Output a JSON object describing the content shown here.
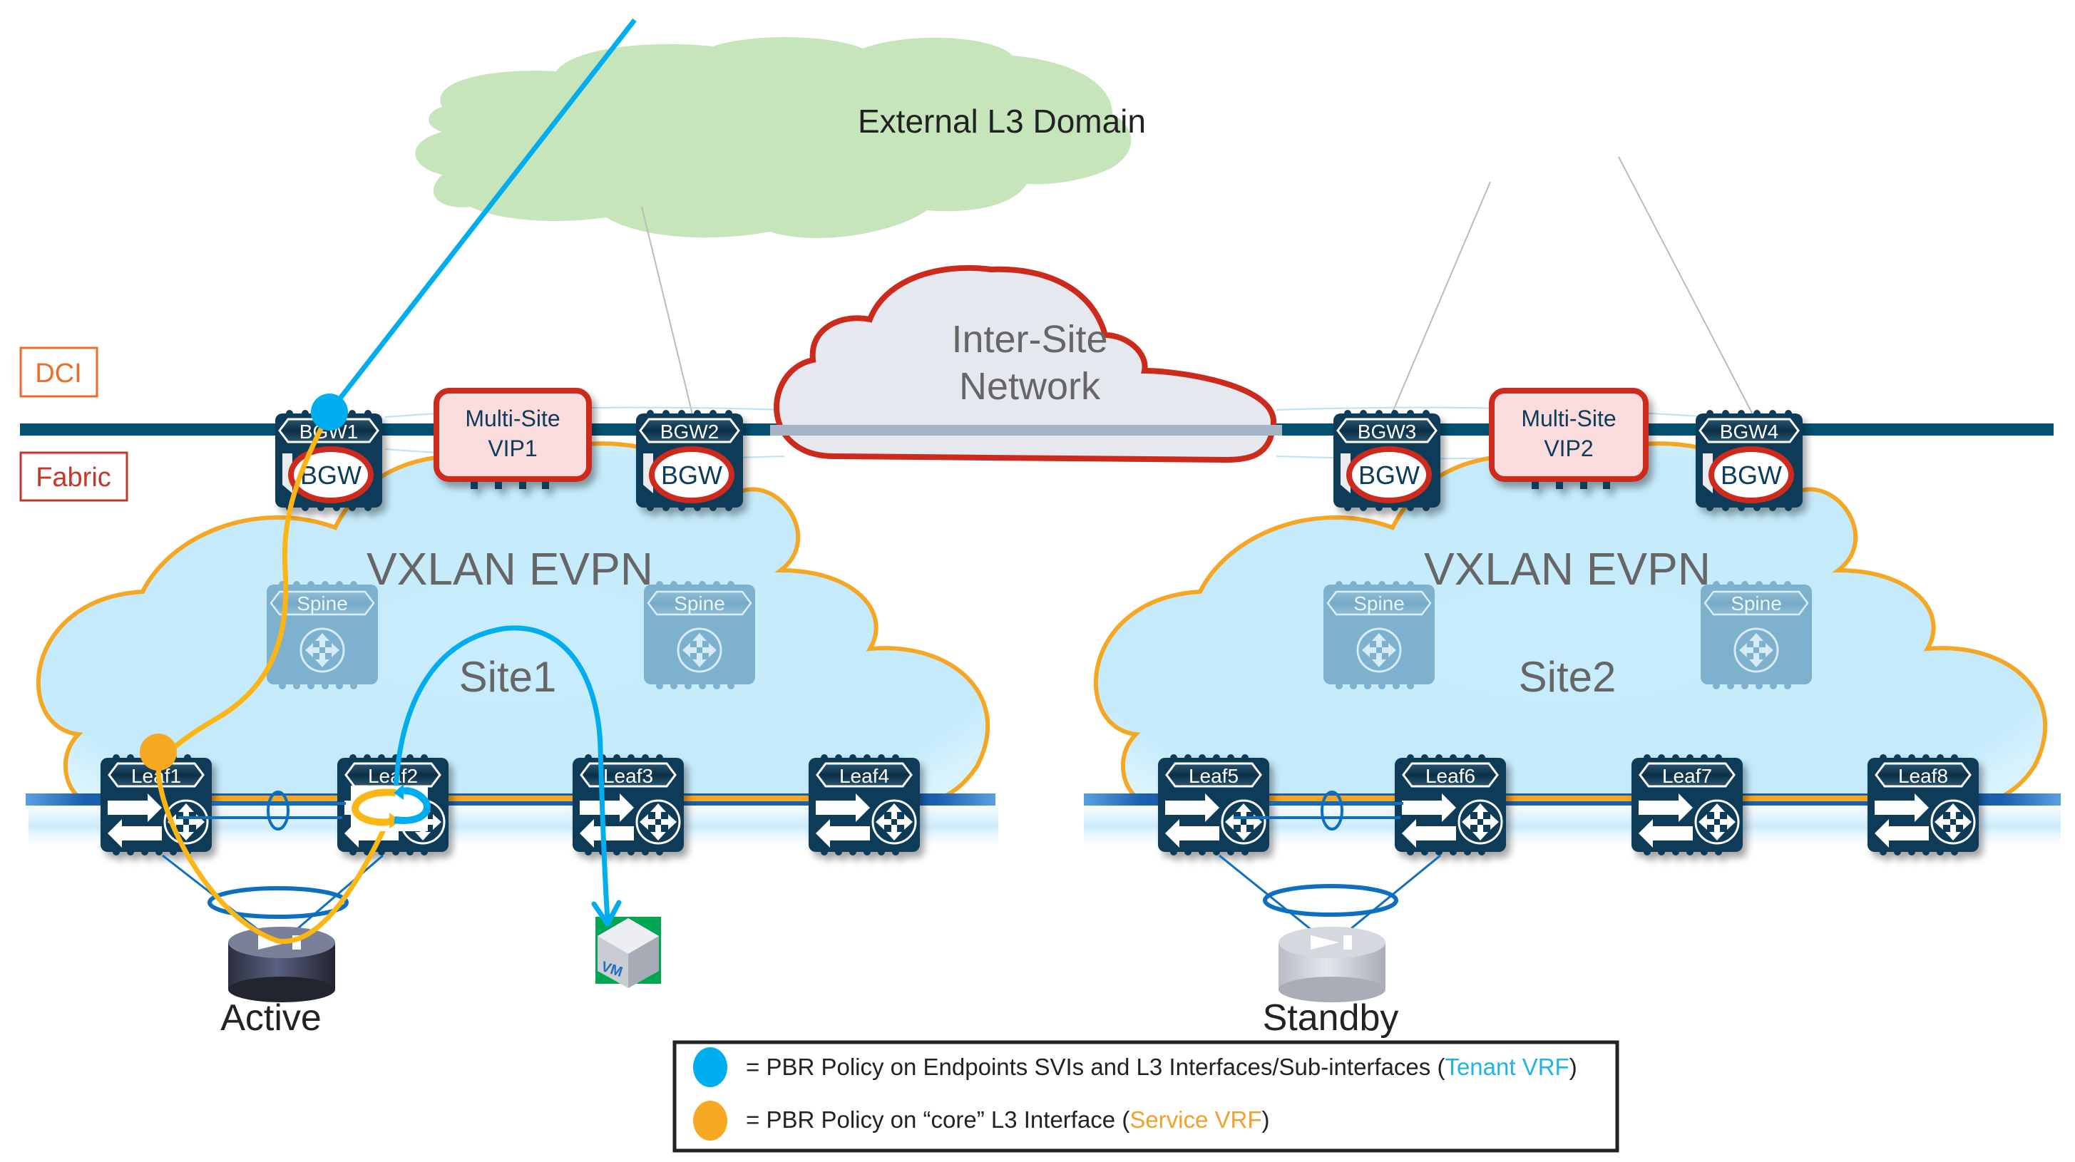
{
  "external_cloud": {
    "label": "External L3 Domain"
  },
  "inter_site_cloud": {
    "line1": "Inter-Site",
    "line2": "Network"
  },
  "layers": {
    "dci": "DCI",
    "fabric": "Fabric"
  },
  "sites": [
    {
      "name": "Site1",
      "fabric_label": "VXLAN EVPN",
      "vip": {
        "line1": "Multi-Site",
        "line2": "VIP1"
      },
      "bgws": [
        {
          "label": "BGW1",
          "badge": "BGW"
        },
        {
          "label": "BGW2",
          "badge": "BGW"
        }
      ],
      "spines": [
        {
          "label": "Spine"
        },
        {
          "label": "Spine"
        }
      ],
      "leafs": [
        {
          "label": "Leaf1"
        },
        {
          "label": "Leaf2"
        },
        {
          "label": "Leaf3"
        },
        {
          "label": "Leaf4"
        }
      ],
      "service_node": {
        "label": "Active"
      },
      "endpoint": {
        "label": "VM"
      }
    },
    {
      "name": "Site2",
      "fabric_label": "VXLAN EVPN",
      "vip": {
        "line1": "Multi-Site",
        "line2": "VIP2"
      },
      "bgws": [
        {
          "label": "BGW3",
          "badge": "BGW"
        },
        {
          "label": "BGW4",
          "badge": "BGW"
        }
      ],
      "spines": [
        {
          "label": "Spine"
        },
        {
          "label": "Spine"
        }
      ],
      "leafs": [
        {
          "label": "Leaf5"
        },
        {
          "label": "Leaf6"
        },
        {
          "label": "Leaf7"
        },
        {
          "label": "Leaf8"
        }
      ],
      "service_node": {
        "label": "Standby"
      }
    }
  ],
  "legend": {
    "items": [
      {
        "icon": "blue-dot-icon",
        "color": "#00aeef",
        "text": "= PBR Policy on Endpoints SVIs and L3 Interfaces/Sub-interfaces (",
        "vrf": "Tenant VRF",
        "vrf_color": "#1eb4e6",
        "close": ")"
      },
      {
        "icon": "orange-dot-icon",
        "color": "#f7a823",
        "text": "= PBR Policy on “core” L3 Interface (",
        "vrf": "Service VRF",
        "vrf_color": "#f2a12a",
        "close": ")"
      }
    ]
  },
  "colors": {
    "tenant_path": "#00aeef",
    "service_path": "#fbb616",
    "fabric_outline": "#f5a623",
    "device_navy": "#0a3b58",
    "dci_line": "#03506f",
    "fabric_fill": "#c9ecfb",
    "external_cloud": "#c6e5bb",
    "accent_red": "#cc2a1c",
    "dci_label": "#ee6c2b",
    "fabric_label": "#c0392b"
  }
}
